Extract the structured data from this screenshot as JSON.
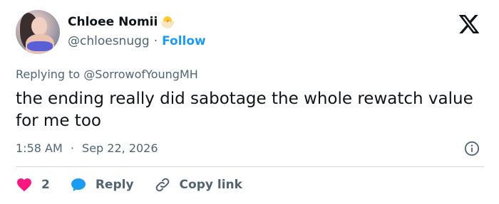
{
  "author": {
    "display_name": "Chloee Nomii",
    "handle": "@chloesnugg",
    "separator": "·",
    "follow_label": "Follow",
    "badge_icon": "hatching-chick-icon"
  },
  "tweet": {
    "replying_prefix": "Replying to",
    "replying_to": "@SorrowofYoungMH",
    "text": "the ending really did sabotage the whole rewatch value for me too",
    "time": "1:58 AM",
    "date_separator": "·",
    "date": "Sep 22, 2026"
  },
  "actions": {
    "like_count": "2",
    "reply_label": "Reply",
    "copy_link_label": "Copy link"
  },
  "colors": {
    "accent": "#1d9bf0",
    "like": "#f91880",
    "muted": "#536471",
    "text": "#0f1419"
  }
}
